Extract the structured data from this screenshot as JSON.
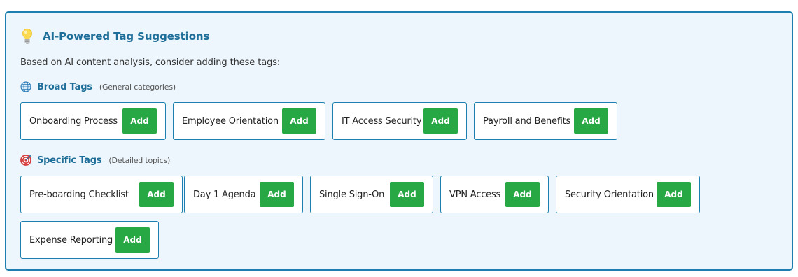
{
  "header": {
    "title": "AI-Powered Tag Suggestions",
    "icon": "lightbulb-icon"
  },
  "description": "Based on AI content analysis, consider adding these tags:",
  "broad": {
    "title": "Broad Tags",
    "subtitle": "(General categories)",
    "icon": "globe-icon",
    "tags": [
      {
        "label": "Onboarding Process",
        "button": "Add"
      },
      {
        "label": "Employee Orientation",
        "button": "Add"
      },
      {
        "label": "IT Access Security",
        "button": "Add"
      },
      {
        "label": "Payroll and Benefits",
        "button": "Add"
      }
    ]
  },
  "specific": {
    "title": "Specific Tags",
    "subtitle": "(Detailed topics)",
    "icon": "target-icon",
    "tags": [
      {
        "label": "Pre-boarding Checklist",
        "button": "Add"
      },
      {
        "label": "Day 1 Agenda",
        "button": "Add"
      },
      {
        "label": "Single Sign-On",
        "button": "Add"
      },
      {
        "label": "VPN Access",
        "button": "Add"
      },
      {
        "label": "Security Orientation",
        "button": "Add"
      },
      {
        "label": "Expense Reporting",
        "button": "Add"
      }
    ]
  },
  "colors": {
    "accent": "#1e6e9a",
    "border": "#1c7fb0",
    "panel_bg": "#edf6fc",
    "add_button": "#28a745"
  }
}
